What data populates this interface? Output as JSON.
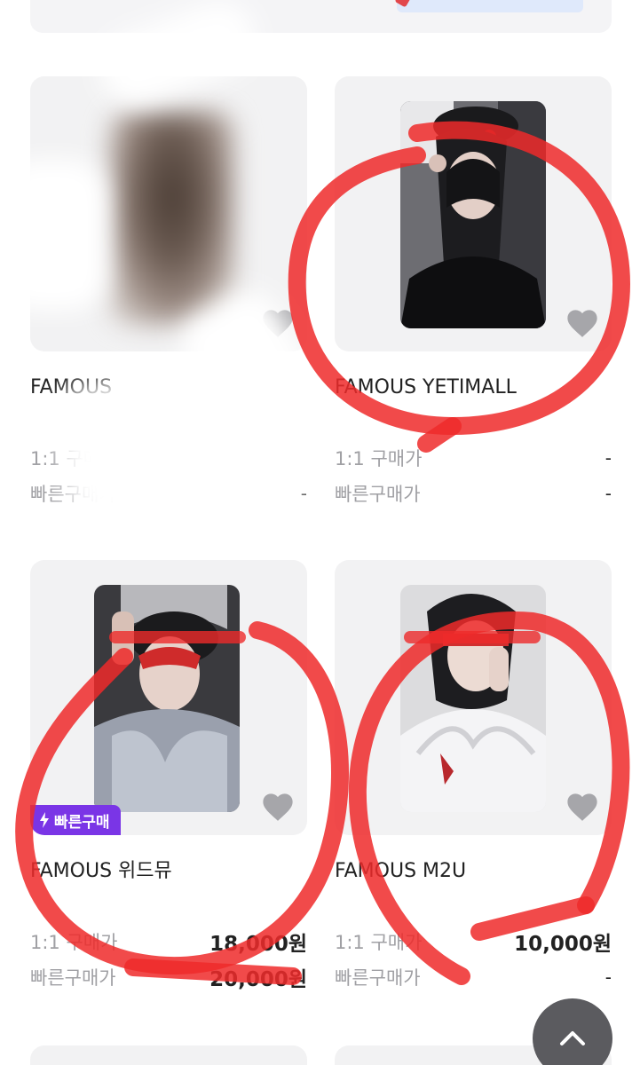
{
  "products": [
    {
      "title": "FAMOUS",
      "price_label": "1:1 구매가",
      "price_value": "",
      "fast_label": "빠른구매가",
      "fast_value": "-",
      "blurred": true,
      "fast_badge": false
    },
    {
      "title": "FAMOUS YETIMALL",
      "price_label": "1:1 구매가",
      "price_value": "-",
      "fast_label": "빠른구매가",
      "fast_value": "-",
      "blurred": false,
      "fast_badge": false
    },
    {
      "title": "FAMOUS 위드뮤",
      "price_label": "1:1 구매가",
      "price_value": "18,000원",
      "fast_label": "빠른구매가",
      "fast_value": "20,000원",
      "blurred": false,
      "fast_badge": true
    },
    {
      "title": "FAMOUS M2U",
      "price_label": "1:1 구매가",
      "price_value": "10,000원",
      "fast_label": "빠른구매가",
      "fast_value": "-",
      "blurred": false,
      "fast_badge": false
    }
  ],
  "badge": {
    "label": "빠른구매"
  },
  "icons": {
    "heart": "heart-icon",
    "bolt": "lightning-icon",
    "scroll_top": "chevron-up-icon"
  },
  "colors": {
    "card_bg": "#f2f2f3",
    "badge_bg": "#7a35e6",
    "heart": "#a6a6aa",
    "scroll_button": "#5b5b5f",
    "annotation_red": "#ee2a2a"
  }
}
